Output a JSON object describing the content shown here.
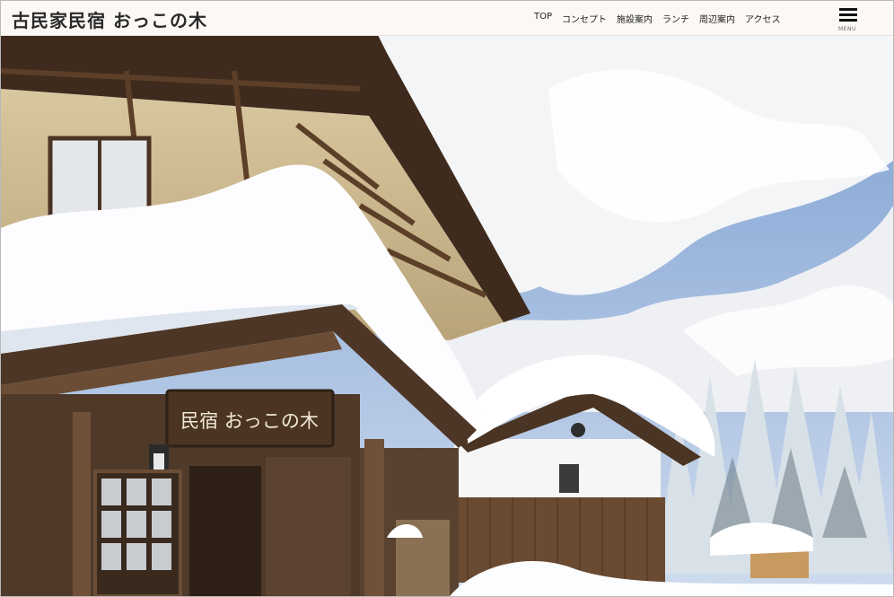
{
  "site": {
    "title": "古民家民宿 おっこの木"
  },
  "nav": {
    "items": [
      {
        "label": "TOP"
      },
      {
        "label": "コンセプト"
      },
      {
        "label": "施設案内"
      },
      {
        "label": "ランチ"
      },
      {
        "label": "周辺案内"
      },
      {
        "label": "アクセス"
      }
    ]
  },
  "menu_button": {
    "label": "MENU",
    "icon": "hamburger-icon"
  },
  "hero": {
    "alt": "雪に覆われた古民家民宿の外観",
    "signboard_text": "民宿 おっこの木"
  },
  "colors": {
    "header_bg": "#fbf8f5",
    "sky": "#5f88c6",
    "wood": "#5b3e28",
    "snow": "#fdfdff"
  }
}
